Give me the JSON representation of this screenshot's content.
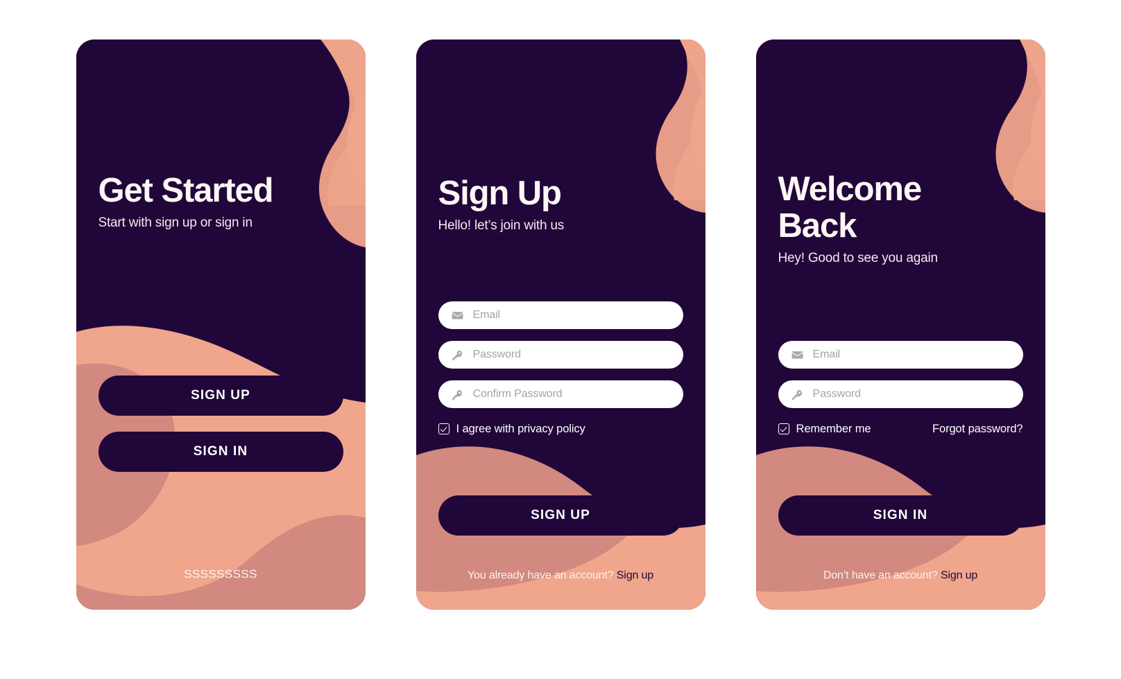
{
  "palette": {
    "dark_purple": "#210639",
    "peach_light": "#EFA68C",
    "peach_mid": "#E79C87",
    "salmon_dark": "#D2897F",
    "white": "#FFFFFF",
    "placeholder_grey": "#A3A3A3"
  },
  "screens": [
    {
      "id": "get-started",
      "title": "Get Started",
      "subtitle": "Start with sign up or sign in",
      "primary_button": "SIGN UP",
      "secondary_button": "SIGN IN",
      "brandmark": "SSSSSSSSS"
    },
    {
      "id": "sign-up",
      "title": "Sign Up",
      "subtitle": "Hello! let’s join with us",
      "fields": [
        {
          "name": "email",
          "placeholder": "Email",
          "icon": "envelope-icon",
          "value": ""
        },
        {
          "name": "password",
          "placeholder": "Password",
          "icon": "key-icon",
          "value": ""
        },
        {
          "name": "confirm-password",
          "placeholder": "Confirm Password",
          "icon": "key-icon",
          "value": ""
        }
      ],
      "checkbox": {
        "label": "I agree with privacy policy",
        "checked": true
      },
      "submit_button": "SIGN UP",
      "footer": {
        "text": "You already have an account?",
        "link": "Sign up"
      }
    },
    {
      "id": "welcome-back",
      "title": "Welcome\nBack",
      "subtitle": "Hey! Good to see you again",
      "fields": [
        {
          "name": "email",
          "placeholder": "Email",
          "icon": "envelope-icon",
          "value": ""
        },
        {
          "name": "password",
          "placeholder": "Password",
          "icon": "key-icon",
          "value": ""
        }
      ],
      "checkbox": {
        "label": "Remember me",
        "checked": true
      },
      "forgot_link": "Forgot password?",
      "submit_button": "SIGN IN",
      "footer": {
        "text": "Don’t have an account?",
        "link": "Sign up"
      }
    }
  ]
}
